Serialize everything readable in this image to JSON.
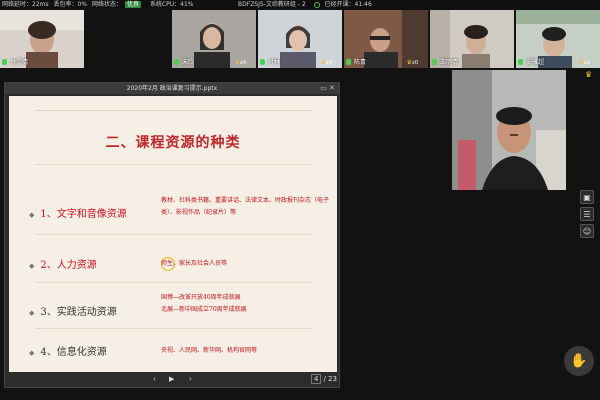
{
  "statusbar": {
    "network_latency": "网络延时：22ms",
    "packet_loss": "丢包率：0%",
    "network_status_label": "网络状态：",
    "network_status_value": "优良",
    "cpu": "系统CPU：41%",
    "meeting_title": "BDFZSJS-文综教研组 - 2",
    "elapsed": "已经开课：41:46"
  },
  "participants": [
    {
      "name": "付雪倩",
      "count": ""
    },
    {
      "name": "宋欣",
      "count": "x4"
    },
    {
      "name": "付林",
      "count": "x4"
    },
    {
      "name": "陈青",
      "count": "x0"
    },
    {
      "name": "王明倩",
      "count": ""
    },
    {
      "name": "安雅超",
      "count": "x1"
    }
  ],
  "presentation": {
    "window_title": "2020年2月 政治课复习提示.pptx",
    "slide": {
      "heading": "二、课程资源的种类",
      "items": [
        {
          "label": "1、文字和音像资源",
          "desc": "教材、社科类书籍、重要讲话、法律文本、时政报刊杂志（电子类）、影视作品（纪录片）等"
        },
        {
          "label": "2、人力资源",
          "desc": "师生、家长及社会人员等"
        },
        {
          "label": "3、实践活动资源",
          "desc_lines": [
            "国博—改革开放40周年成就展",
            "北展—新中国成立70周年成就展"
          ]
        },
        {
          "label": "4、信息化资源",
          "desc": "央视、人民网、新华网、机构官网等"
        }
      ]
    },
    "nav": {
      "prev": "‹",
      "play": "▶",
      "next": "›",
      "current_page": "4",
      "total_pages": "/ 23"
    }
  },
  "icons": {
    "window_controls": "▭ ✕",
    "side_tools": [
      "image-icon",
      "list-icon",
      "people-icon"
    ],
    "hand": "raise-hand-icon"
  }
}
